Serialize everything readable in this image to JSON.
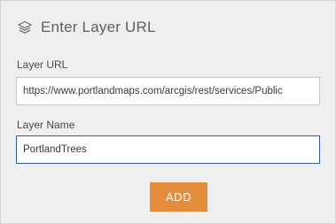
{
  "panel": {
    "title": "Enter Layer URL",
    "title_icon": "layers-icon"
  },
  "form": {
    "url_label": "Layer URL",
    "url_value": "https://www.portlandmaps.com/arcgis/rest/services/Public",
    "name_label": "Layer Name",
    "name_value": "PortlandTrees"
  },
  "actions": {
    "add_label": "ADD"
  },
  "colors": {
    "panel_bg": "#efefef",
    "accent_button": "#e48d3d",
    "focus_border": "#2f5d95"
  }
}
